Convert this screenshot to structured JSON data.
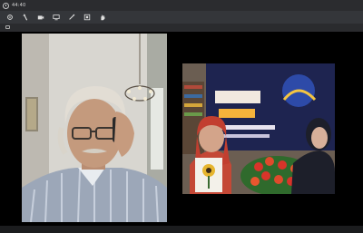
{
  "titlebar": {
    "time": "44:40"
  },
  "toolbar": {
    "icons": [
      "eye-icon",
      "pen-icon",
      "camera-icon",
      "screen-icon",
      "draw-icon",
      "frame-icon",
      "hand-icon"
    ]
  },
  "colors": {
    "background": "#000000",
    "toolbar": "#34363a",
    "titlebar": "#2b2c2f"
  }
}
